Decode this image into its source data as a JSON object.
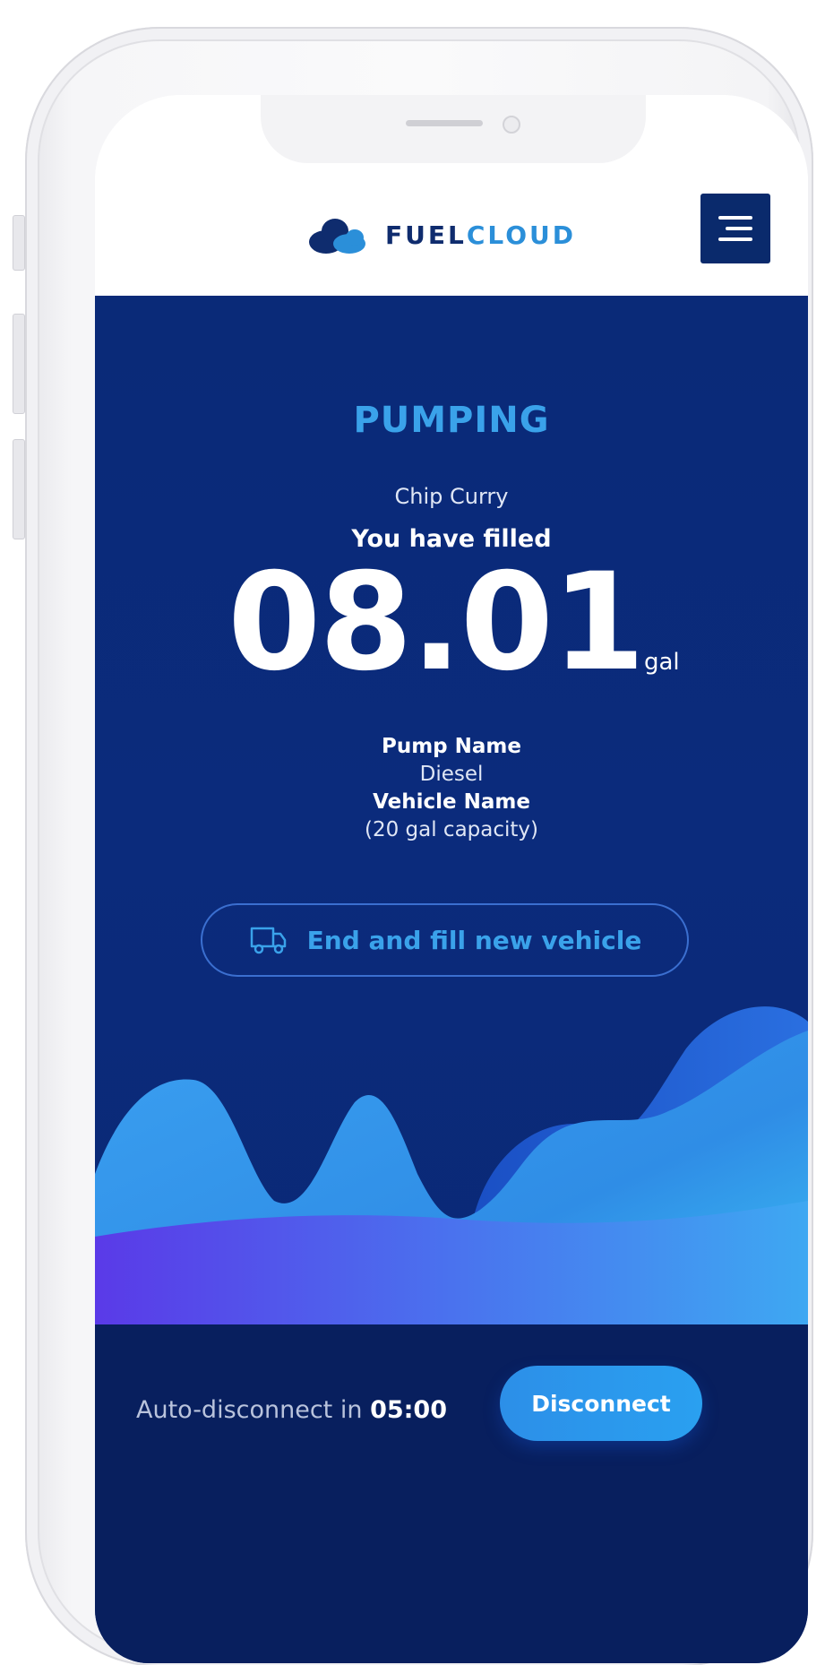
{
  "brand": {
    "name_part1": "FUEL",
    "name_part2": "CLOUD",
    "color_dark": "#0f2c6e",
    "color_light": "#2b8fd9"
  },
  "header": {
    "menu_icon": "menu-icon"
  },
  "session": {
    "status": "PUMPING",
    "user_name": "Chip Curry",
    "filled_label": "You have filled",
    "amount": "08.01",
    "unit": "gal"
  },
  "details": {
    "pump_label": "Pump Name",
    "pump_value": "Diesel",
    "vehicle_label": "Vehicle Name",
    "vehicle_value": "(20 gal capacity)"
  },
  "actions": {
    "end_fill_label": "End and fill new vehicle",
    "end_fill_icon": "truck-icon"
  },
  "footer": {
    "auto_prefix": "Auto-disconnect in ",
    "auto_time": "05:00",
    "disconnect_label": "Disconnect"
  },
  "colors": {
    "panel_bg": "#0b2b7c",
    "accent": "#3aa2ea",
    "footer_bg": "#081f5e"
  }
}
